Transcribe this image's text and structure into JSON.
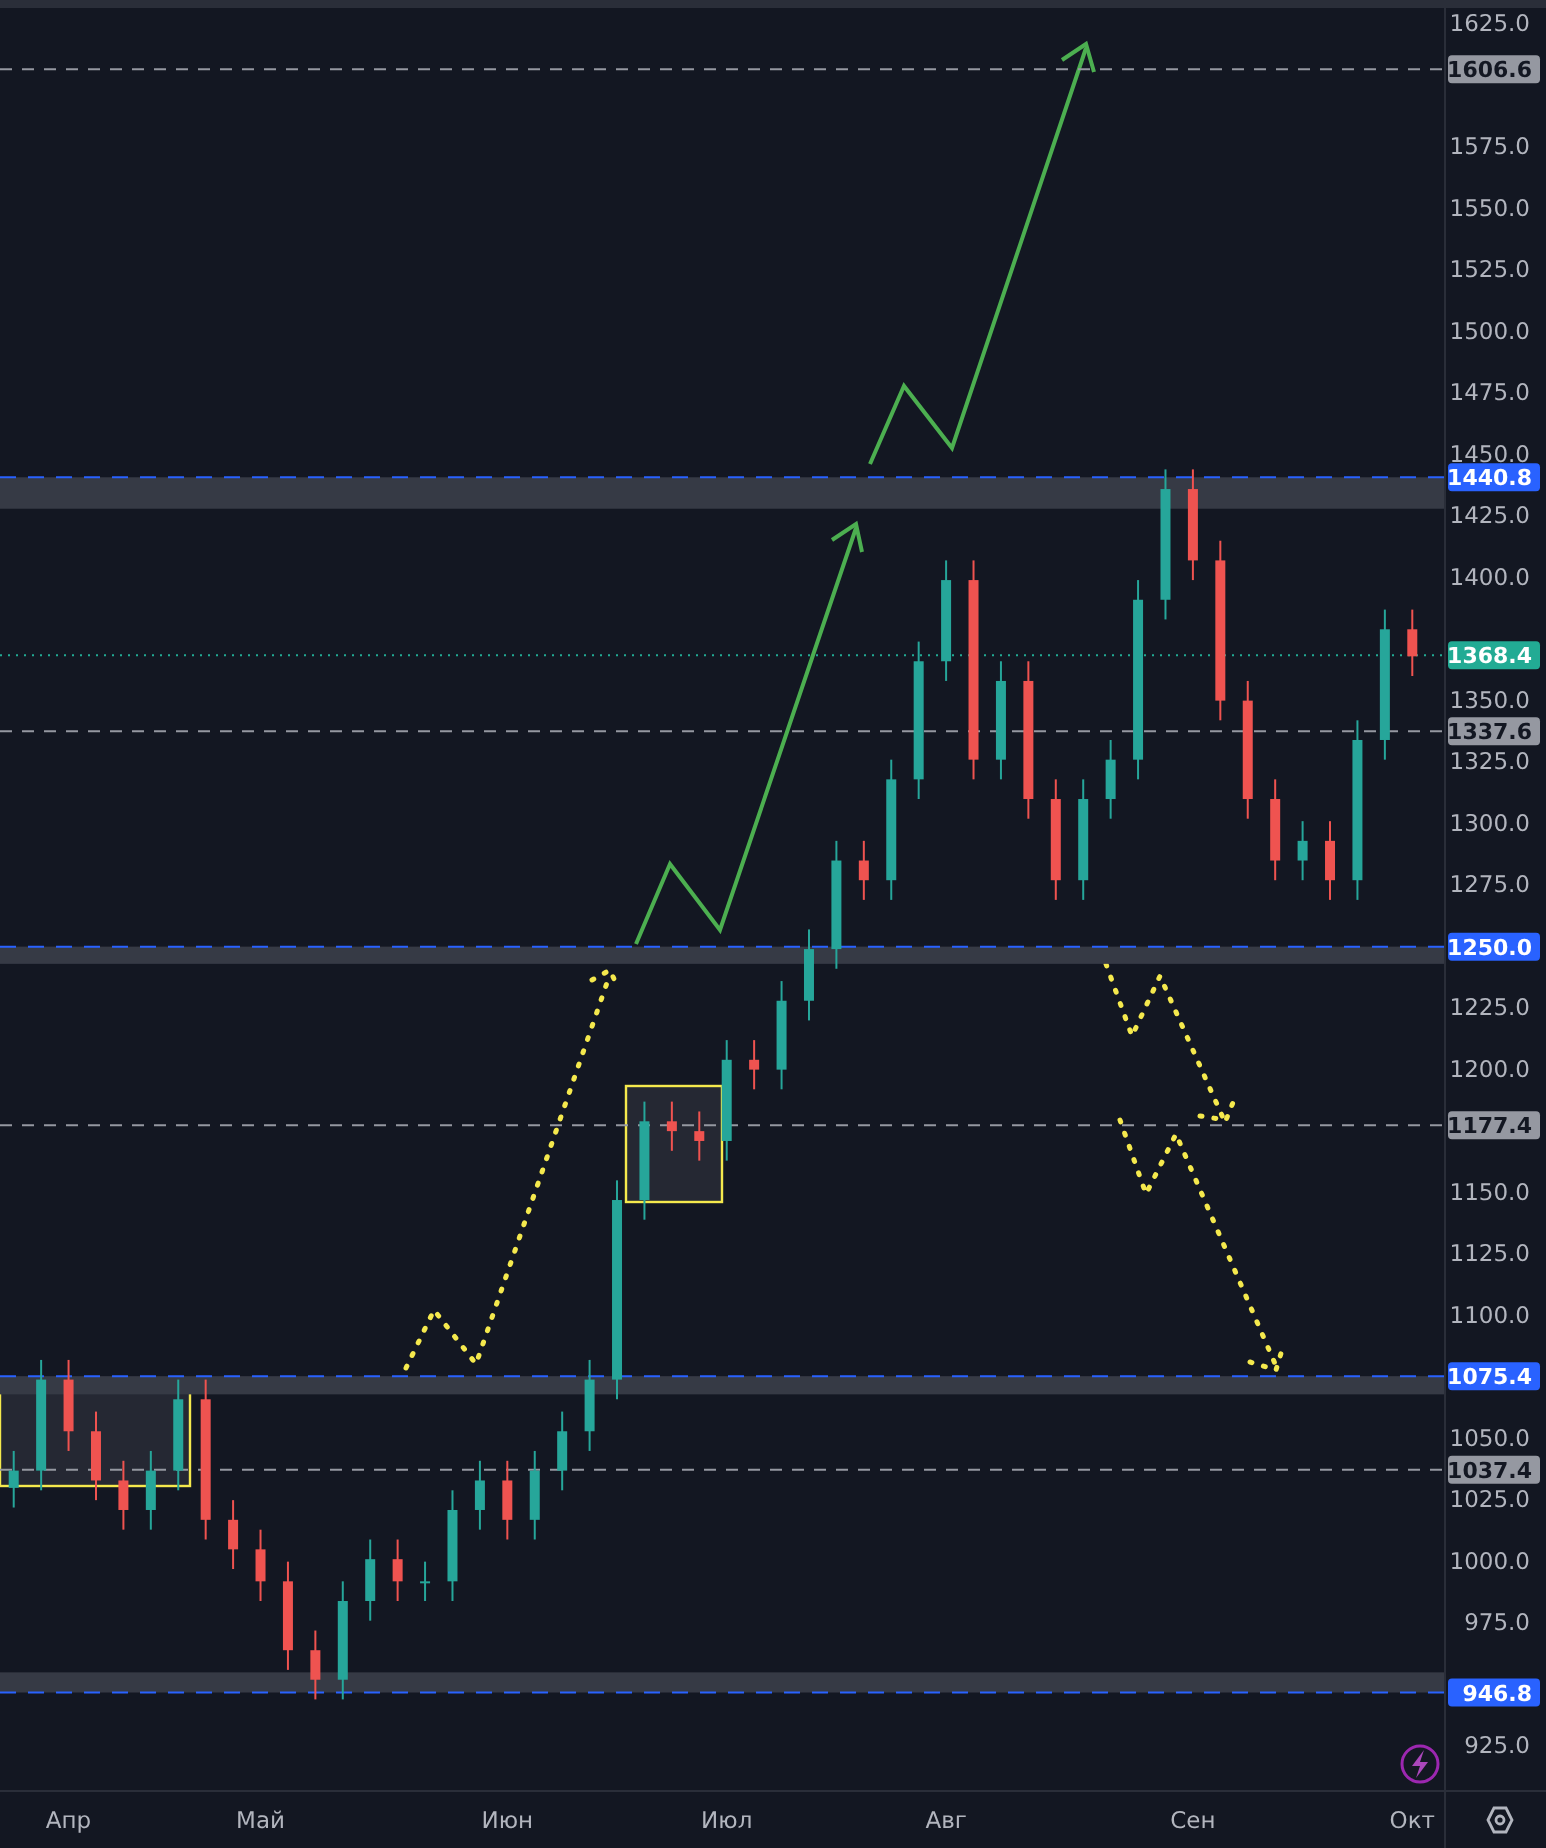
{
  "chart": {
    "chart_data": {
      "type": "candlestick",
      "ylim": [
        883.6,
        1634.8
      ],
      "categories": [
        null,
        null,
        "Апр",
        null,
        null,
        null,
        null,
        null,
        null,
        "Май",
        null,
        null,
        null,
        null,
        null,
        null,
        null,
        null,
        "Июн",
        null,
        null,
        null,
        null,
        null,
        null,
        null,
        "Июл",
        null,
        null,
        null,
        null,
        null,
        null,
        null,
        "Авг",
        null,
        null,
        null,
        null,
        null,
        null,
        null,
        null,
        "Сен",
        null,
        null,
        null,
        null,
        null,
        null,
        null,
        "Окт"
      ],
      "ohlc": [
        [
          1030,
          1045,
          1022,
          1037
        ],
        [
          1037,
          1082,
          1029,
          1074
        ],
        [
          1074,
          1082,
          1045,
          1053
        ],
        [
          1053,
          1061,
          1025,
          1033
        ],
        [
          1033,
          1041,
          1013,
          1021
        ],
        [
          1021,
          1045,
          1013,
          1037
        ],
        [
          1037,
          1074,
          1029,
          1066
        ],
        [
          1066,
          1074,
          1009,
          1017
        ],
        [
          1017,
          1025,
          997,
          1005
        ],
        [
          1005,
          1013,
          984,
          992
        ],
        [
          992,
          1000,
          956,
          964
        ],
        [
          964,
          972,
          944,
          952
        ],
        [
          952,
          992,
          944,
          984
        ],
        [
          984,
          1009,
          976,
          1001
        ],
        [
          1001,
          1009,
          984,
          992
        ],
        [
          992,
          1000,
          984,
          992
        ],
        [
          992,
          1029,
          984,
          1021
        ],
        [
          1021,
          1041,
          1013,
          1033
        ],
        [
          1033,
          1041,
          1009,
          1017
        ],
        [
          1017,
          1045,
          1009,
          1037
        ],
        [
          1037,
          1061,
          1029,
          1053
        ],
        [
          1053,
          1082,
          1045,
          1074
        ],
        [
          1074,
          1155,
          1066,
          1147
        ],
        [
          1147,
          1187,
          1139,
          1179
        ],
        [
          1179,
          1187,
          1167,
          1175
        ],
        [
          1175,
          1183,
          1163,
          1171
        ],
        [
          1171,
          1212,
          1163,
          1204
        ],
        [
          1204,
          1212,
          1192,
          1200
        ],
        [
          1200,
          1236,
          1192,
          1228
        ],
        [
          1228,
          1257,
          1220,
          1249
        ],
        [
          1249,
          1293,
          1241,
          1285
        ],
        [
          1285,
          1293,
          1269,
          1277
        ],
        [
          1277,
          1326,
          1269,
          1318
        ],
        [
          1318,
          1374,
          1310,
          1366
        ],
        [
          1366,
          1407,
          1358,
          1399
        ],
        [
          1399,
          1407,
          1318,
          1326
        ],
        [
          1326,
          1366,
          1318,
          1358
        ],
        [
          1358,
          1366,
          1302,
          1310
        ],
        [
          1310,
          1318,
          1269,
          1277
        ],
        [
          1277,
          1318,
          1269,
          1310
        ],
        [
          1310,
          1334,
          1302,
          1326
        ],
        [
          1326,
          1399,
          1318,
          1391
        ],
        [
          1391,
          1444,
          1383,
          1436
        ],
        [
          1436,
          1444,
          1399,
          1407
        ],
        [
          1407,
          1415,
          1342,
          1350
        ],
        [
          1350,
          1358,
          1302,
          1310
        ],
        [
          1310,
          1318,
          1277,
          1285
        ],
        [
          1285,
          1301,
          1277,
          1293
        ],
        [
          1293,
          1301,
          1269,
          1277
        ],
        [
          1277,
          1342,
          1269,
          1334
        ],
        [
          1334,
          1387,
          1326,
          1379
        ],
        [
          1379,
          1387,
          1360,
          1368
        ]
      ],
      "yticks": [
        {
          "value": 925,
          "label": "925.0"
        },
        {
          "value": 975,
          "label": "975.0"
        },
        {
          "value": 1000,
          "label": "1000.0"
        },
        {
          "value": 1025,
          "label": "1025.0"
        },
        {
          "value": 1050,
          "label": "1050.0"
        },
        {
          "value": 1100,
          "label": "1100.0"
        },
        {
          "value": 1125,
          "label": "1125.0"
        },
        {
          "value": 1150,
          "label": "1150.0"
        },
        {
          "value": 1200,
          "label": "1200.0"
        },
        {
          "value": 1225,
          "label": "1225.0"
        },
        {
          "value": 1275,
          "label": "1275.0"
        },
        {
          "value": 1300,
          "label": "1300.0"
        },
        {
          "value": 1325,
          "label": "1325.0"
        },
        {
          "value": 1350,
          "label": "1350.0"
        },
        {
          "value": 1400,
          "label": "1400.0"
        },
        {
          "value": 1425,
          "label": "1425.0"
        },
        {
          "value": 1450,
          "label": "1450.0"
        },
        {
          "value": 1475,
          "label": "1475.0"
        },
        {
          "value": 1500,
          "label": "1500.0"
        },
        {
          "value": 1525,
          "label": "1525.0"
        },
        {
          "value": 1550,
          "label": "1550.0"
        },
        {
          "value": 1575,
          "label": "1575.0"
        },
        {
          "value": 1625,
          "label": "1625.0"
        }
      ],
      "bands": [
        {
          "axis": "y",
          "from": 1428,
          "to": 1440.8,
          "color": "#363a45"
        },
        {
          "axis": "y",
          "from": 1243,
          "to": 1250,
          "color": "#363a45"
        },
        {
          "axis": "y",
          "from": 1068,
          "to": 1075.4,
          "color": "#363a45"
        },
        {
          "axis": "y",
          "from": 946.8,
          "to": 955,
          "color": "#363a45"
        }
      ],
      "ref_lines": [
        {
          "axis": "y",
          "value": 1606.6,
          "label": "1606.6",
          "color": "#9598a1"
        },
        {
          "axis": "y",
          "value": 1440.8,
          "label": "1440.8",
          "color": "#2962ff"
        },
        {
          "axis": "y",
          "value": 1368.4,
          "label": "1368.4",
          "color": "#22ab94"
        },
        {
          "axis": "y",
          "value": 1337.6,
          "label": "1337.6",
          "color": "#9598a1"
        },
        {
          "axis": "y",
          "value": 1250.0,
          "label": "1250.0",
          "color": "#2962ff"
        },
        {
          "axis": "y",
          "value": 1177.4,
          "label": "1177.4",
          "color": "#9598a1"
        },
        {
          "axis": "y",
          "value": 1075.4,
          "label": "1075.4",
          "color": "#2962ff"
        },
        {
          "axis": "y",
          "value": 1037.4,
          "label": "1037.4",
          "color": "#9598a1"
        },
        {
          "axis": "y",
          "value": 946.8,
          "label": "946.8",
          "color": "#2962ff"
        }
      ]
    }
  }
}
